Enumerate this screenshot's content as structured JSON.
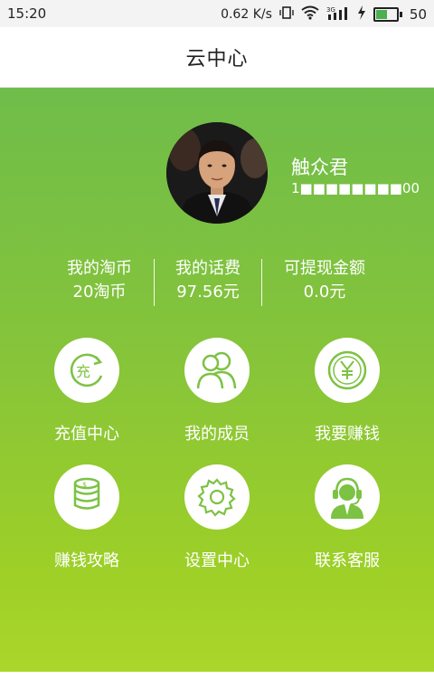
{
  "status_bar": {
    "time": "15:20",
    "net_speed": "0.62 K/s",
    "signal": "3G",
    "battery": "50"
  },
  "header": {
    "title": "云中心"
  },
  "profile": {
    "name": "触众君",
    "phone": "1■■■■■■■■00"
  },
  "stats": [
    {
      "label": "我的淘币",
      "value": "20淘币"
    },
    {
      "label": "我的话费",
      "value": "97.56元"
    },
    {
      "label": "可提现金额",
      "value": "0.0元"
    }
  ],
  "menu": [
    {
      "label": "充值中心",
      "icon": "recharge-icon"
    },
    {
      "label": "我的成员",
      "icon": "members-icon"
    },
    {
      "label": "我要赚钱",
      "icon": "yen-coin-icon"
    },
    {
      "label": "赚钱攻略",
      "icon": "coin-stack-icon"
    },
    {
      "label": "设置中心",
      "icon": "gear-icon"
    },
    {
      "label": "联系客服",
      "icon": "customer-service-icon"
    }
  ],
  "colors": {
    "accent_green": "#6fbd4a",
    "accent_light": "#acd62a",
    "icon_green": "#7cc243"
  }
}
